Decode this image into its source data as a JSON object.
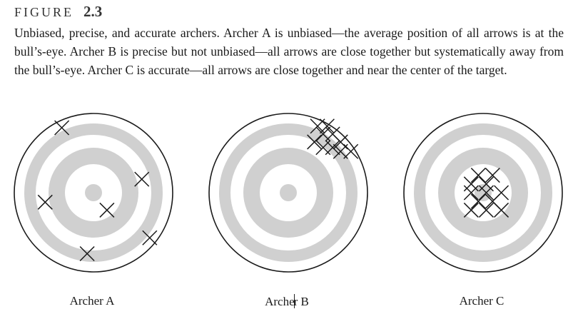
{
  "figure": {
    "word": "FIGURE",
    "number": "2.3",
    "caption": "Unbiased, precise, and accurate archers. Archer A is unbiased—the average position of all arrows is at the bull’s-eye. Archer B is precise but not unbiased—all arrows are close together but systematically away from the bull’s-eye. Archer C is accurate—all arrows are close together and near the center of the target."
  },
  "colors": {
    "ring": "#d0d0d0",
    "ink": "#1a1a1a",
    "paper": "#ffffff"
  },
  "targets": [
    {
      "label_part1": "Archer A",
      "label_part2": "",
      "arrows": [
        [
          -0.4,
          -0.82
        ],
        [
          0.61,
          -0.17
        ],
        [
          -0.61,
          0.12
        ],
        [
          0.17,
          0.22
        ],
        [
          0.71,
          0.57
        ],
        [
          -0.08,
          0.77
        ]
      ]
    },
    {
      "label_part1": "Arche",
      "label_part2": "r B",
      "arrows": [
        [
          0.37,
          -0.84
        ],
        [
          0.49,
          -0.84
        ],
        [
          0.44,
          -0.74
        ],
        [
          0.56,
          -0.74
        ],
        [
          0.66,
          -0.64
        ],
        [
          0.33,
          -0.64
        ],
        [
          0.44,
          -0.57
        ],
        [
          0.56,
          -0.57
        ],
        [
          0.66,
          -0.52
        ],
        [
          0.79,
          -0.52
        ]
      ]
    },
    {
      "label_part1": "Archer C",
      "label_part2": "",
      "arrows": [
        [
          -0.06,
          -0.22
        ],
        [
          0.12,
          -0.22
        ],
        [
          -0.15,
          -0.11
        ],
        [
          0.04,
          -0.11
        ],
        [
          -0.15,
          0.0
        ],
        [
          0.04,
          0.0
        ],
        [
          0.23,
          0.0
        ],
        [
          -0.06,
          0.11
        ],
        [
          0.12,
          0.11
        ],
        [
          -0.15,
          0.22
        ],
        [
          0.04,
          0.22
        ],
        [
          0.23,
          0.22
        ]
      ]
    }
  ]
}
